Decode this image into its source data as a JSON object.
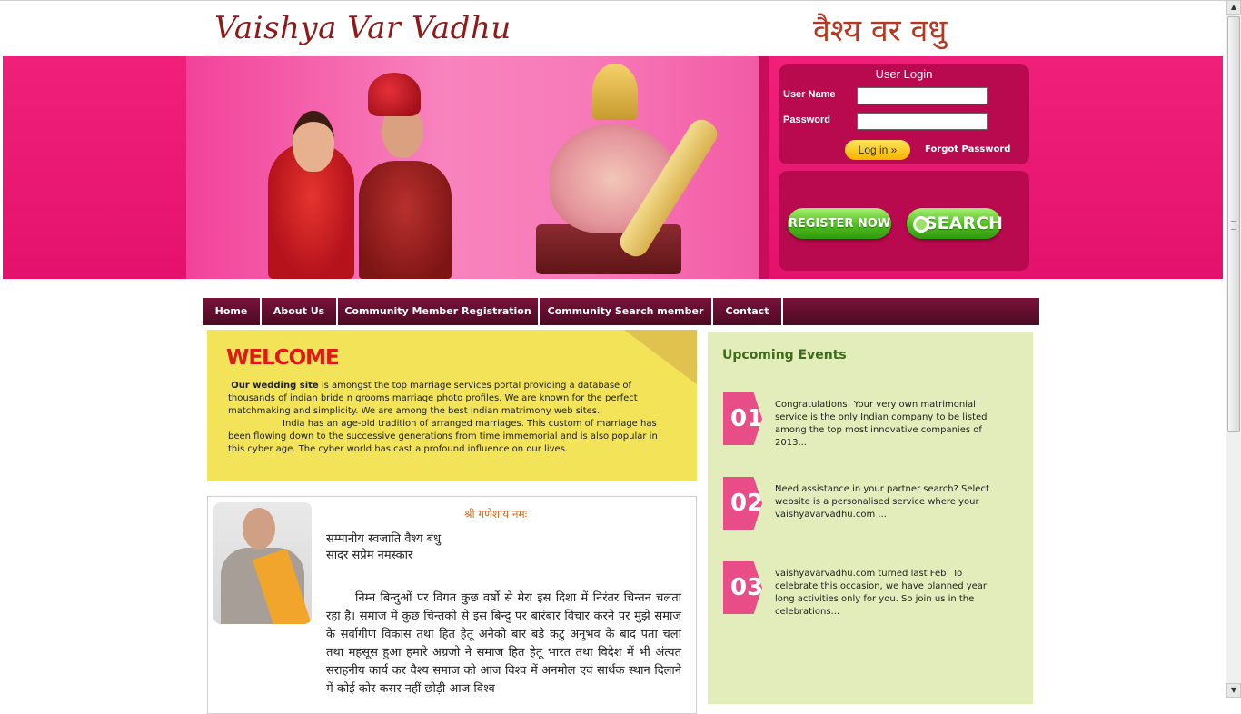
{
  "header": {
    "logo_en": "Vaishya Var Vadhu",
    "logo_hi": "वैश्य वर वधु"
  },
  "login": {
    "title": "User Login",
    "username_label": "User Name",
    "username_value": "",
    "password_label": "Password",
    "password_value": "",
    "login_button": "Log in »",
    "forgot_link": "Forgot Password"
  },
  "actions": {
    "register_button": "REGISTER NOW",
    "search_button": "SEARCH"
  },
  "nav": {
    "items": [
      "Home",
      "About Us",
      "Community Member Registration",
      "Community Search member",
      "Contact"
    ]
  },
  "welcome": {
    "title": "WELCOME",
    "lead_bold": "Our wedding site",
    "para1": " is amongst the top marriage services portal providing a database of thousands of indian bride n grooms marriage photo profiles. We are known for the perfect matchmaking and simplicity. We are among the best Indian matrimony web sites.",
    "para2": "India has an age-old tradition of arranged marriages. This custom of marriage has been flowing down to the successive generations from time immemorial and is also popular in this cyber age. The cyber world has cast a profound influence on our lives."
  },
  "message": {
    "heading": "श्री गणेशाय नमः",
    "greeting_line1": "सम्मानीय स्वजाति वैश्य बंधु",
    "greeting_line2": "सादर सप्रेम नमस्कार",
    "body": "निम्न बिन्दुओं पर विगत कुछ वर्षो से मेरा इस दिशा में निरंतर चिन्तन चलता रहा है। समाज में कुछ चिन्तको से इस बिन्दु पर बारंबार विचार करने पर मुझे समाज के सर्वागीण विकास तथा हित हेतू अनेको बार बडे कटु अनुभव के बाद पता चला तथा महसूस हुआ हमारे अग्रजो ने समाज हित हेतू भारत तथा विदेश में भी अंत्यत सराहनीय कार्य कर वैश्य समाज को आज विश्व में अनमोल एवं सार्थक स्थान दिलाने में कोई कोर कसर नहीं छोड़ी आज विश्व"
  },
  "events": {
    "title": "Upcoming Events",
    "items": [
      {
        "num": "01",
        "text": "Congratulations! Your very own matrimonial service is the only Indian company to be listed among the top most innovative companies of 2013..."
      },
      {
        "num": "02",
        "text": "Need assistance in your partner search? Select website is a personalised service where your vaishyavarvadhu.com ..."
      },
      {
        "num": "03",
        "text": "vaishyavarvadhu.com turned last Feb! To celebrate this occasion, we have planned year long activities only for you. So join us in the celebrations..."
      }
    ]
  },
  "colors": {
    "banner_pink": "#e4126c",
    "login_box": "#b90a4f",
    "nav_bg": "#4a0b22",
    "welcome_bg": "#f2e358",
    "welcome_title": "#e01818",
    "events_bg": "#e3ecbb",
    "events_title": "#3f6b1a",
    "event_badge": "#e94d88"
  },
  "icons": {
    "search_button_icon": "magnifier-icon"
  }
}
